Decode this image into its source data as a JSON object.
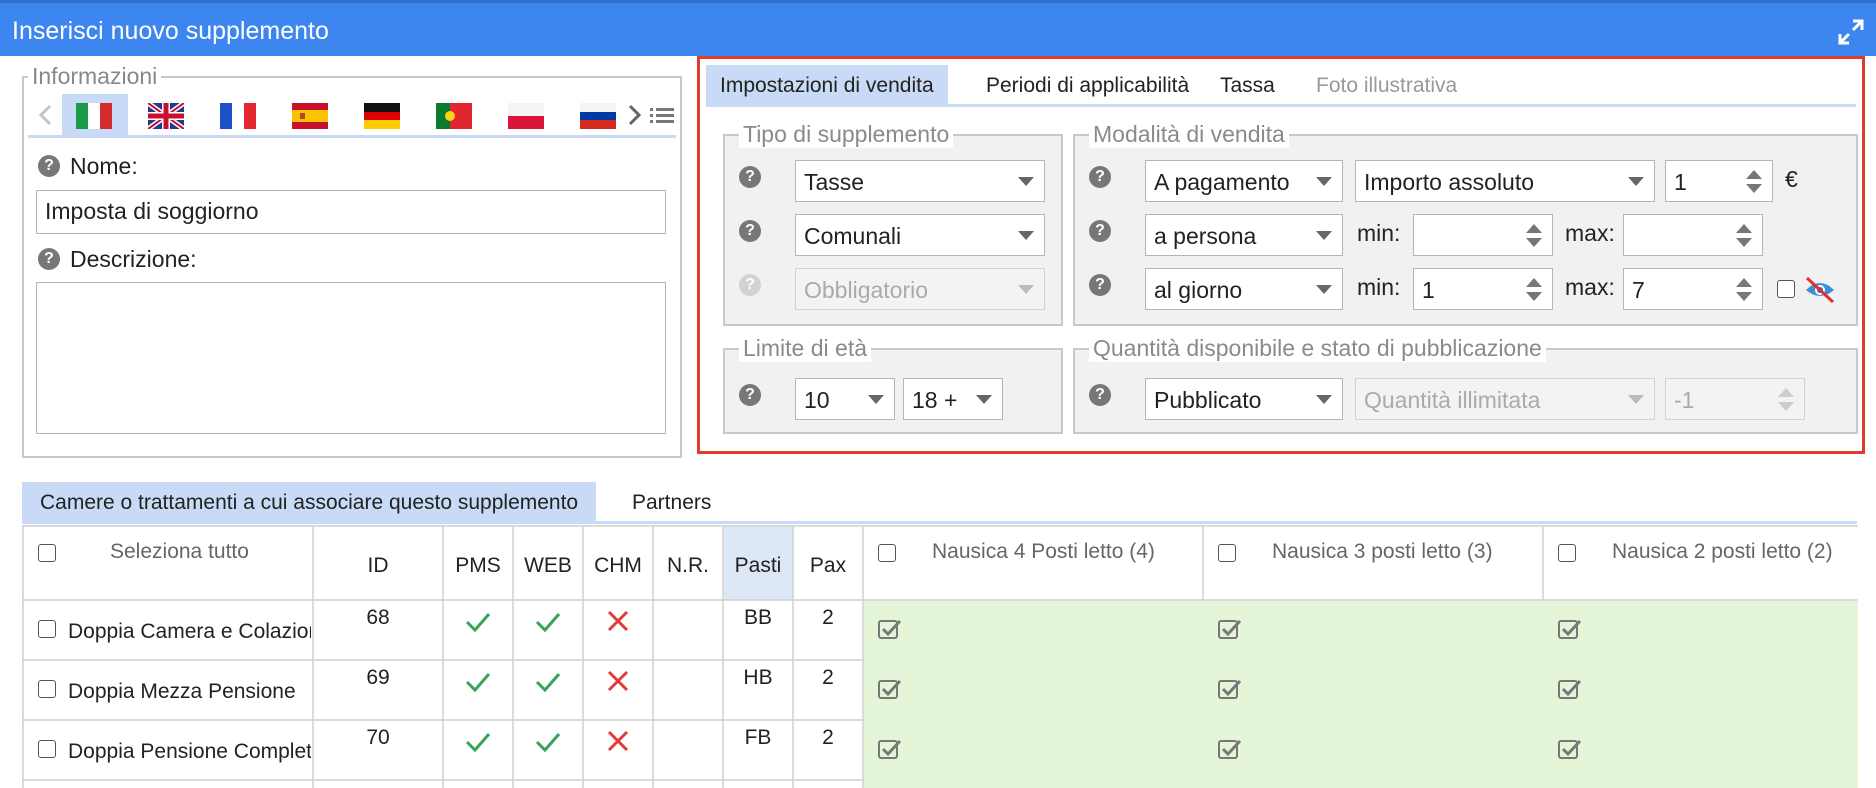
{
  "window": {
    "title": "Inserisci nuovo supplemento"
  },
  "info": {
    "legend": "Informazioni",
    "name_label": "Nome:",
    "name_value": "Imposta di soggiorno",
    "description_label": "Descrizione:",
    "flags": [
      "it-flag-icon",
      "uk-flag-icon",
      "fr-flag-icon",
      "es-flag-icon",
      "de-flag-icon",
      "pt-flag-icon",
      "pl-flag-icon",
      "ru-flag-icon"
    ]
  },
  "tabs": [
    "Impostazioni di vendita",
    "Periodi di applicabilità",
    "Tassa",
    "Foto illustrativa"
  ],
  "tipo": {
    "legend": "Tipo di supplemento",
    "select1": "Tasse",
    "select2": "Comunali",
    "select3": "Obbligatorio"
  },
  "modalita": {
    "legend": "Modalità di vendita",
    "payment": "A pagamento",
    "amount_type": "Importo assoluto",
    "amount": "1",
    "currency": "€",
    "per": "a persona",
    "per_min_label": "min:",
    "per_min": "",
    "per_max_label": "max:",
    "per_max": "",
    "period": "al giorno",
    "period_min_label": "min:",
    "period_min": "1",
    "period_max_label": "max:",
    "period_max": "7"
  },
  "eta": {
    "legend": "Limite di età",
    "min": "10",
    "max": "18 +"
  },
  "quantita": {
    "legend": "Quantità disponibile e stato di pubblicazione",
    "status": "Pubblicato",
    "quantity": "Quantità illimitata",
    "value": "-1"
  },
  "bottom_tabs": [
    "Camere o trattamenti a cui associare questo supplemento",
    "Partners"
  ],
  "table": {
    "select_all": "Seleziona tutto",
    "headers": [
      "ID",
      "PMS",
      "WEB",
      "CHM",
      "N.R.",
      "Pasti",
      "Pax"
    ],
    "rooms": [
      "Nausica 4 Posti letto (4)",
      "Nausica 3 posti letto (3)",
      "Nausica 2 posti letto (2)"
    ],
    "rows": [
      {
        "name": "Doppia Camera e Colazione",
        "id": "68",
        "pasti": "BB",
        "pax": "2"
      },
      {
        "name": "Doppia Mezza Pensione",
        "id": "69",
        "pasti": "HB",
        "pax": "2"
      },
      {
        "name": "Doppia Pensione Completa",
        "id": "70",
        "pasti": "FB",
        "pax": "2"
      }
    ]
  },
  "colors": {
    "titlebar": "#3d86f0",
    "active_tab": "#c8daf5",
    "highlight_border": "#e23a2c",
    "check_green": "#3aa35a",
    "cross_red": "#e03a3a"
  }
}
